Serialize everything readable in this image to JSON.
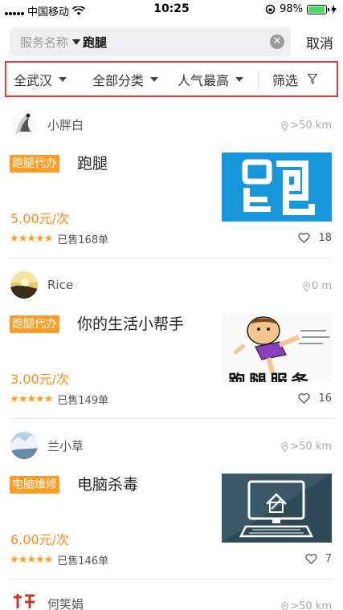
{
  "status_bar": {
    "carrier": "中国移动",
    "time": "10:25",
    "battery": "98%",
    "battery_level": 0.98
  },
  "search": {
    "type_label": "服务名称",
    "query": "跑腿",
    "clear_icon": "clear-icon",
    "cancel_label": "取消"
  },
  "filters": {
    "region": "全武汉",
    "category": "全部分类",
    "sort": "人气最高",
    "filter_label": "筛选"
  },
  "colors": {
    "accent_orange": "#ff9c22",
    "price_orange": "#ff8c1a",
    "highlight_border": "#e23a3a"
  },
  "services": [
    {
      "user": "小胖白",
      "distance": ">50 km",
      "tag": "跑腿代办",
      "title": "跑腿",
      "price": "5.00元/次",
      "rating": 5,
      "sold": "已售168单",
      "likes": "18"
    },
    {
      "user": "Rice",
      "distance": "0 m",
      "tag": "跑腿代办",
      "title": "你的生活小帮手",
      "price": "3.00元/次",
      "rating": 5,
      "sold": "已售149单",
      "likes": "16",
      "image_text": "跑腿服务"
    },
    {
      "user": "兰小草",
      "distance": ">50 km",
      "tag": "电脑维修",
      "title": "电脑杀毒",
      "price": "6.00元/次",
      "rating": 5,
      "sold": "已售146单",
      "likes": "7"
    },
    {
      "user": "何笑娟",
      "distance": ">50 km"
    }
  ]
}
